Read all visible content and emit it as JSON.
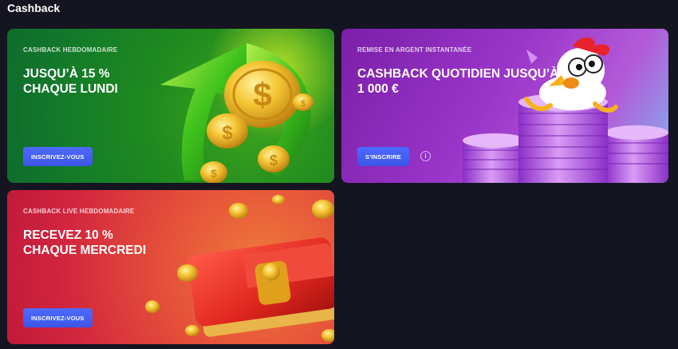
{
  "section": {
    "title": "Cashback"
  },
  "cards": [
    {
      "eyebrow": "CASHBACK HEBDOMADAIRE",
      "headline_lines": [
        "JUSQU’À 15 %",
        "CHAQUE LUNDI"
      ],
      "cta_label": "INSCRIVEZ-VOUS",
      "art_icon": "coins-arrow-icon"
    },
    {
      "eyebrow": "REMISE EN ARGENT INSTANTANÉE",
      "headline_lines": [
        "CASHBACK QUOTIDIEN JUSQU’À",
        "1 000 €"
      ],
      "cta_label": "S’INSCRIRE",
      "info_label": "i",
      "art_icon": "chicken-on-chips-icon"
    },
    {
      "eyebrow": "CASHBACK LIVE HEBDOMADAIRE",
      "headline_lines": [
        "RECEVEZ 10 %",
        "CHAQUE MERCREDI"
      ],
      "cta_label": "INSCRIVEZ-VOUS",
      "art_icon": "wallet-coins-icon"
    }
  ],
  "colors": {
    "page_background": "#141520",
    "cta_blue": "#4d6bff",
    "card_green": "#1f8a1f",
    "card_purple": "#9a35c9",
    "card_red": "#d2253e"
  }
}
